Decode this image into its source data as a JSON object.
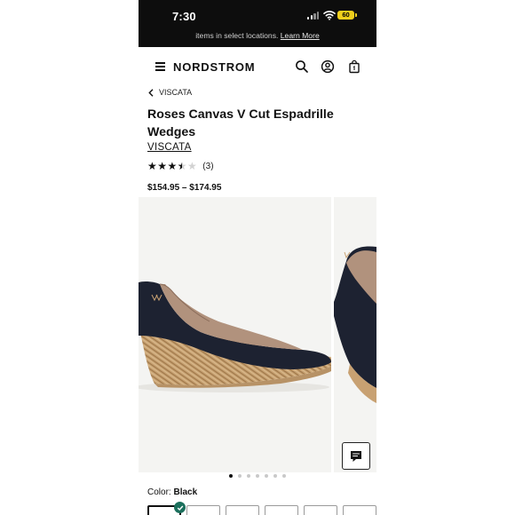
{
  "status_bar": {
    "time": "7:30",
    "battery_label": "60"
  },
  "banner": {
    "text": "items in select locations.",
    "link": "Learn More"
  },
  "nav": {
    "logo": "NORDSTROM"
  },
  "breadcrumb": {
    "label": "VISCATA"
  },
  "product": {
    "title": "Roses Canvas V Cut Espadrille Wedges",
    "brand": "VISCATA",
    "rating": {
      "value": 3.5,
      "max": 5,
      "count_label": "(3)",
      "stars_glyphs": "★★★★★"
    },
    "price": "$154.95 – $174.95"
  },
  "gallery": {
    "slide_count": 7,
    "active_index": 0
  },
  "color": {
    "label": "Color:",
    "value": "Black"
  },
  "colors": {
    "accent": "#1b6f5c",
    "dark": "#0d0d0d",
    "battery": "#f0cf1c"
  }
}
